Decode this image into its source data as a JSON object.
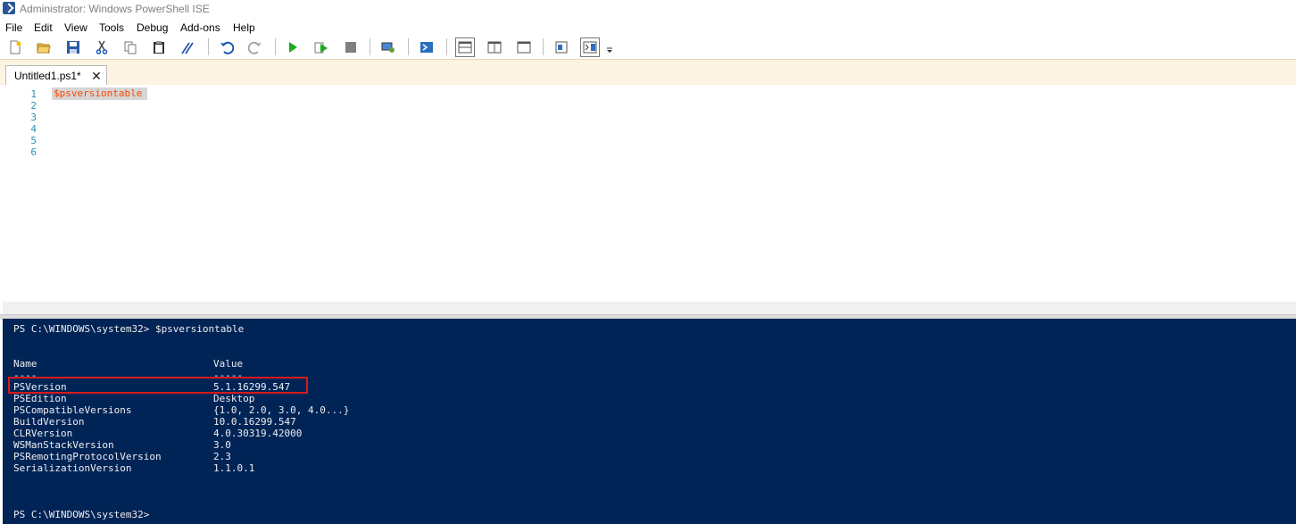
{
  "window": {
    "title": "Administrator: Windows PowerShell ISE"
  },
  "menu": [
    "File",
    "Edit",
    "View",
    "Tools",
    "Debug",
    "Add-ons",
    "Help"
  ],
  "toolbar": {
    "icons": [
      "new-file-icon",
      "open-folder-icon",
      "save-icon",
      "cut-icon",
      "copy-icon",
      "paste-icon",
      "clear-console-icon",
      "undo-icon",
      "redo-icon",
      "run-script-icon",
      "run-selection-icon",
      "stop-icon",
      "remote-tab-icon",
      "powershell-icon",
      "layout-top-icon",
      "layout-right-icon",
      "layout-max-icon",
      "show-commands-icon",
      "show-script-pane-icon"
    ]
  },
  "tabs": [
    {
      "label": "Untitled1.ps1*",
      "close": "✕"
    }
  ],
  "editor": {
    "line_numbers": [
      "1",
      "2",
      "3",
      "4",
      "5",
      "6"
    ],
    "code": "$psversiontable",
    "code_color": "#ff4500"
  },
  "console": {
    "prompt_command": "PS C:\\WINDOWS\\system32> $psversiontable",
    "header_name": "Name",
    "header_value": "Value",
    "underline_name": "----",
    "underline_value": "-----",
    "rows": [
      {
        "name": "PSVersion",
        "value": "5.1.16299.547"
      },
      {
        "name": "PSEdition",
        "value": "Desktop"
      },
      {
        "name": "PSCompatibleVersions",
        "value": "{1.0, 2.0, 3.0, 4.0...}"
      },
      {
        "name": "BuildVersion",
        "value": "10.0.16299.547"
      },
      {
        "name": "CLRVersion",
        "value": "4.0.30319.42000"
      },
      {
        "name": "WSManStackVersion",
        "value": "3.0"
      },
      {
        "name": "PSRemotingProtocolVersion",
        "value": "2.3"
      },
      {
        "name": "SerializationVersion",
        "value": "1.1.0.1"
      }
    ],
    "final_prompt": "PS C:\\WINDOWS\\system32>",
    "background": "#012456",
    "highlight_color": "#d61b1b"
  }
}
